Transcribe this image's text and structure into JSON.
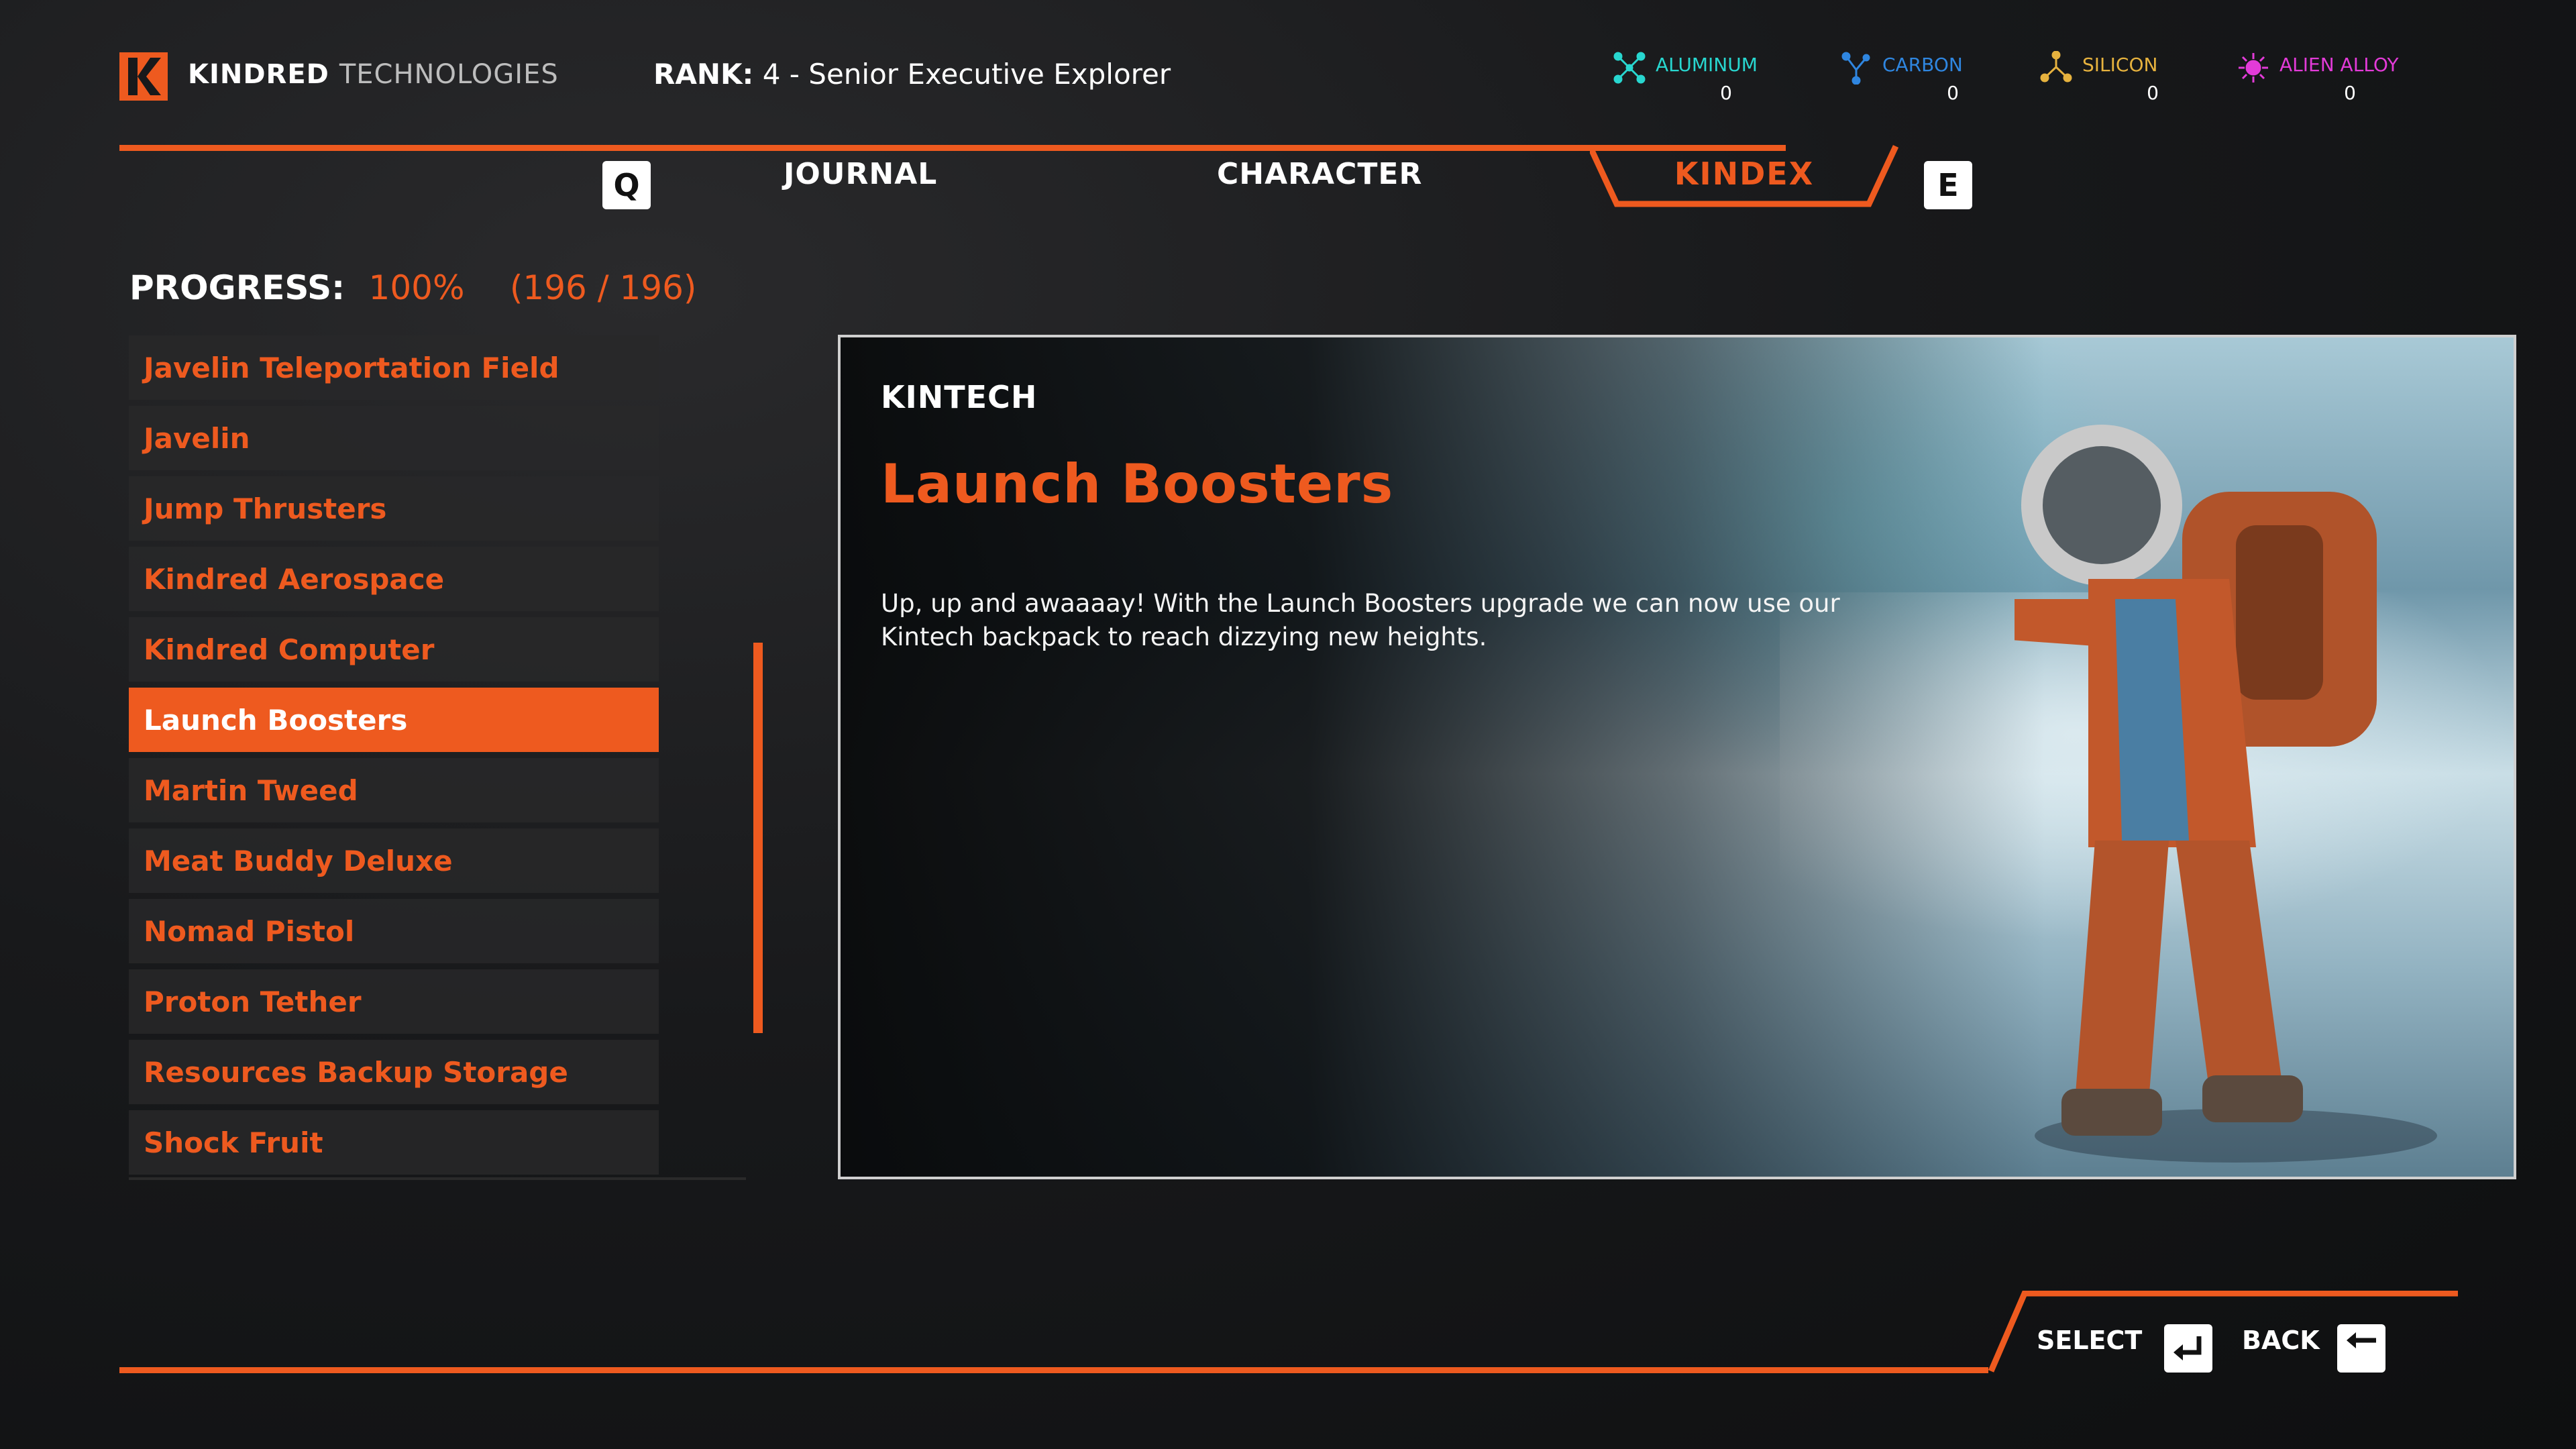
{
  "colors": {
    "accent": "#ee5a1f",
    "aluminum": "#28d7d0",
    "carbon": "#2f86e0",
    "silicon": "#e6b23e",
    "alien_alloy": "#e33bd8"
  },
  "header": {
    "brand_primary": "KINDRED",
    "brand_secondary": "TECHNOLOGIES",
    "rank_label": "RANK:",
    "rank_value": "4 - Senior Executive Explorer"
  },
  "resources": [
    {
      "name": "ALUMINUM",
      "count": "0",
      "icon": "aluminum-icon"
    },
    {
      "name": "CARBON",
      "count": "0",
      "icon": "carbon-icon"
    },
    {
      "name": "SILICON",
      "count": "0",
      "icon": "silicon-icon"
    },
    {
      "name": "ALIEN ALLOY",
      "count": "0",
      "icon": "alien-alloy-icon"
    }
  ],
  "tabs": {
    "prev_key": "Q",
    "next_key": "E",
    "items": [
      {
        "label": "JOURNAL"
      },
      {
        "label": "CHARACTER"
      },
      {
        "label": "KINDEX",
        "active": true
      }
    ]
  },
  "progress": {
    "label": "PROGRESS:",
    "percent": "100%",
    "count": "(196 / 196)"
  },
  "list": {
    "selected_index": 5,
    "items": [
      "Javelin Teleportation Field",
      "Javelin",
      "Jump Thrusters",
      "Kindred Aerospace",
      "Kindred Computer",
      "Launch Boosters",
      "Martin Tweed",
      "Meat Buddy Deluxe",
      "Nomad Pistol",
      "Proton Tether",
      "Resources Backup Storage",
      "Shock Fruit"
    ]
  },
  "detail": {
    "category": "KINTECH",
    "title": "Launch Boosters",
    "description": "Up, up and awaaaay! With the Launch Boosters upgrade we can now use our Kintech backpack to reach dizzying new heights."
  },
  "footer": {
    "select_label": "SELECT",
    "back_label": "BACK"
  }
}
